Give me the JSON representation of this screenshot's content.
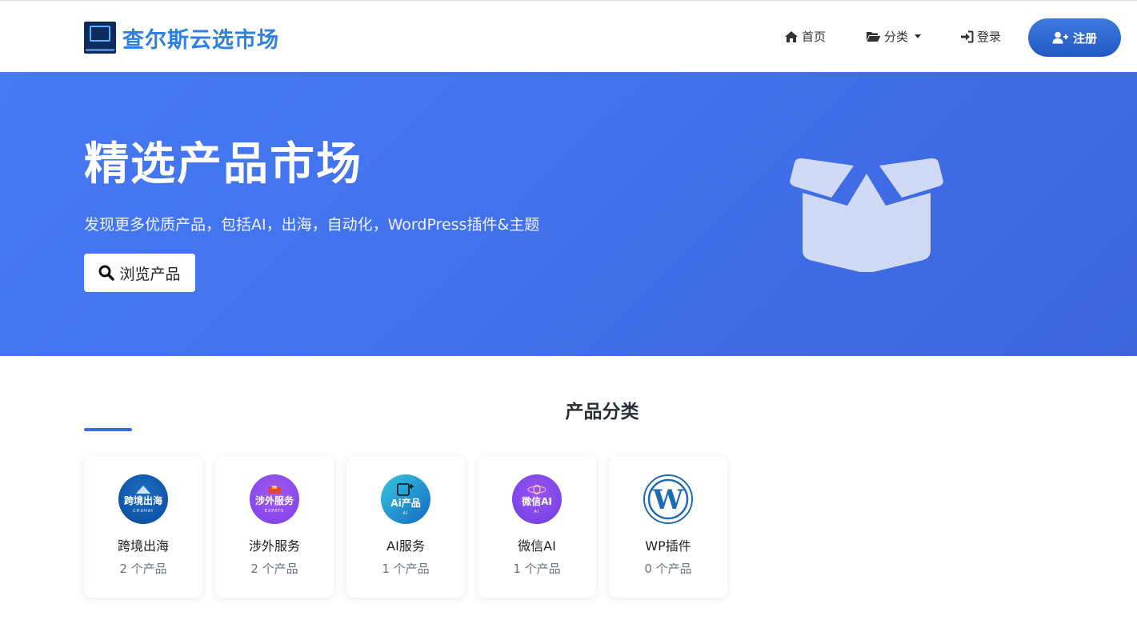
{
  "brand": {
    "name": "查尔斯云选市场"
  },
  "nav": {
    "home": "首页",
    "categories": "分类",
    "login": "登录",
    "register": "注册"
  },
  "hero": {
    "title": "精选产品市场",
    "subtitle": "发现更多优质产品，包括AI，出海，自动化，WordPress插件&主题",
    "browse_button": "浏览产品"
  },
  "section": {
    "title": "产品分类"
  },
  "categories": [
    {
      "name": "跨境出海",
      "count": "2 个产品",
      "logo_text": "跨境出海",
      "logo_small": "CHUHAI"
    },
    {
      "name": "涉外服务",
      "count": "2 个产品",
      "logo_text": "涉外服务",
      "logo_small": "EXPATS"
    },
    {
      "name": "AI服务",
      "count": "1 个产品",
      "logo_text": "Ai产品",
      "logo_small": "AI"
    },
    {
      "name": "微信AI",
      "count": "1 个产品",
      "logo_text": "微信AI",
      "logo_small": "AI"
    },
    {
      "name": "WP插件",
      "count": "0 个产品"
    }
  ],
  "colors": {
    "brand": "#2f80e4",
    "hero": "#4576f0",
    "accent": "#3d6ee0"
  }
}
